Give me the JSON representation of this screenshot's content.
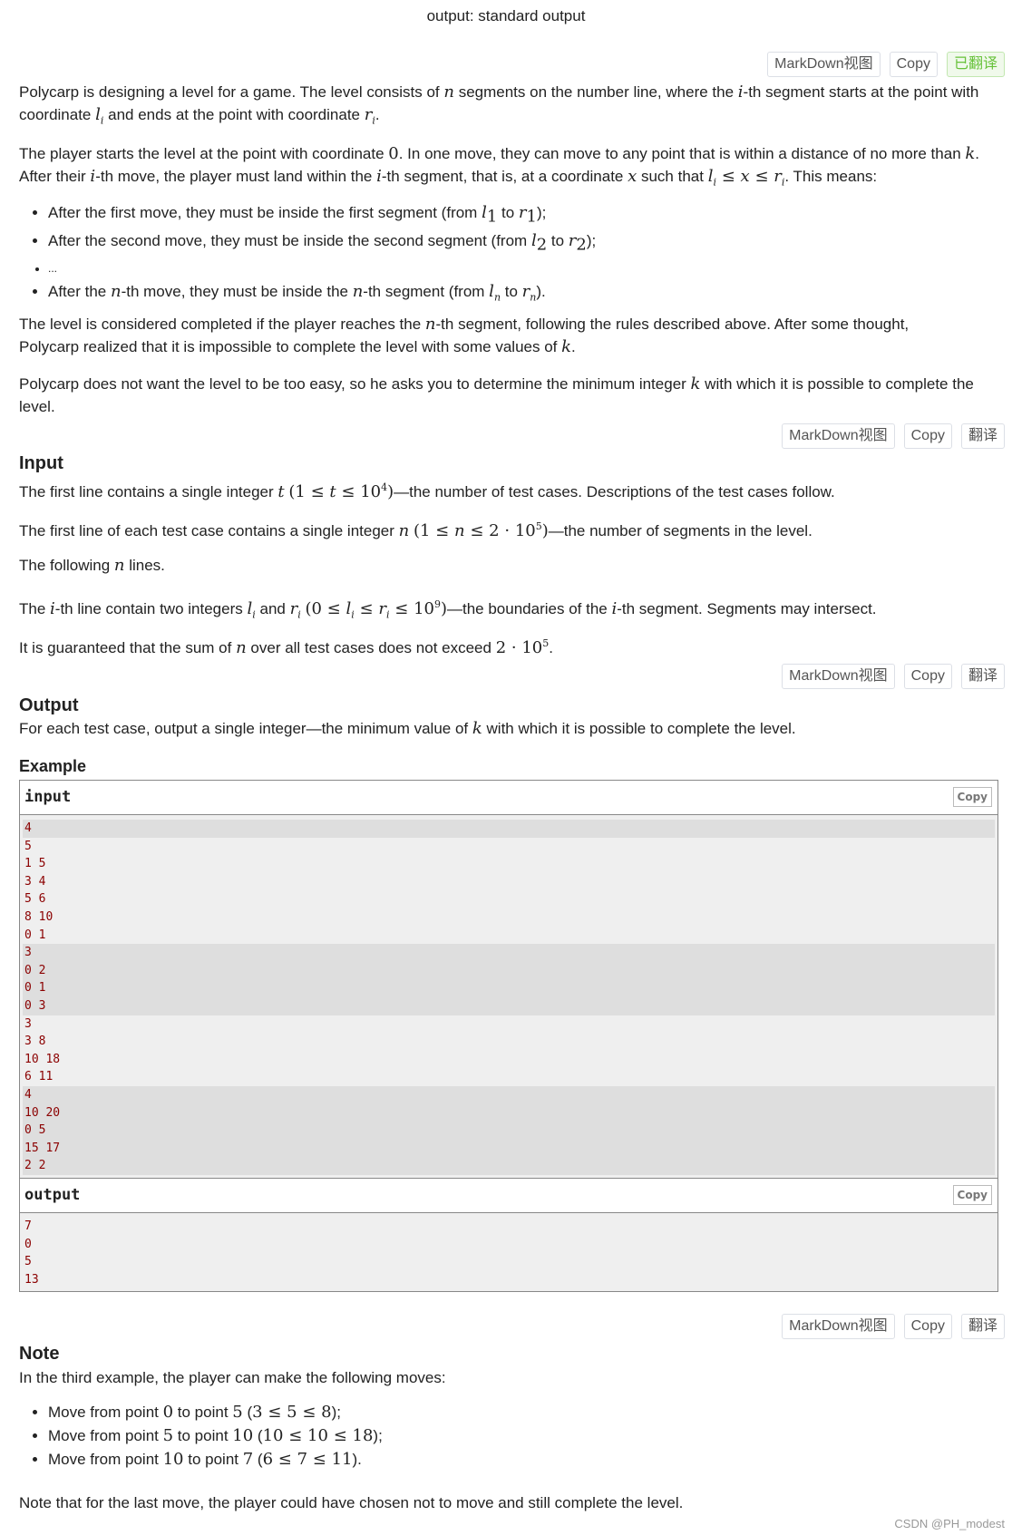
{
  "header": {
    "output_line": "output: standard output"
  },
  "toolbars": {
    "statement": {
      "markdown": "MarkDown视图",
      "copy": "Copy",
      "translate": "已翻译"
    },
    "input": {
      "markdown": "MarkDown视图",
      "copy": "Copy",
      "translate": "翻译"
    },
    "output": {
      "markdown": "MarkDown视图",
      "copy": "Copy",
      "translate": "翻译"
    },
    "note": {
      "markdown": "MarkDown视图",
      "copy": "Copy",
      "translate": "翻译"
    }
  },
  "colors": {
    "translated_green": "#67c23a",
    "code_text": "#8b0000",
    "code_bg": "#efefef",
    "code_alt_bg": "#dedede"
  },
  "statement": {
    "p1_a": "Polycarp is designing a level for a game. The level consists of ",
    "p1_b": " segments on the number line, where the ",
    "p1_c": "-th segment starts at the point with coordinate ",
    "p1_d": " and ends at the point with coordinate ",
    "p1_e": ".",
    "p2_a": "The player starts the level at the point with coordinate ",
    "p2_b": ". In one move, they can move to any point that is within a distance of no more than ",
    "p2_c": ". After their ",
    "p2_d": "-th move, the player must land within the ",
    "p2_e": "-th segment, that is, at a coordinate ",
    "p2_f": " such that ",
    "p2_g": ". This means:",
    "bullets": [
      {
        "a": "After the first move, they must be inside the first segment (from ",
        "l": "l",
        "ls": "1",
        "mid": " to ",
        "r": "r",
        "rs": "1",
        "end": ");"
      },
      {
        "a": "After the second move, they must be inside the second segment (from ",
        "l": "l",
        "ls": "2",
        "mid": " to ",
        "r": "r",
        "rs": "2",
        "end": ");"
      },
      {
        "a": "..."
      },
      {
        "a": "After the ",
        "n": "n",
        "b": "-th move, they must be inside the ",
        "n2": "n",
        "c": "-th segment (from ",
        "l": "l",
        "ls": "n",
        "mid": " to ",
        "r": "r",
        "rs": "n",
        "end": ")."
      }
    ],
    "p3_a": "The level is considered completed if the player reaches the ",
    "p3_b": "-th segment, following the rules described above. After some thought, Polycarp realized that it is impossible to complete the level with some values of ",
    "p3_c": ".",
    "p4_a": "Polycarp does not want the level to be too easy, so he asks you to determine the minimum integer ",
    "p4_b": " with which it is possible to complete the level."
  },
  "math": {
    "n": "n",
    "i": "i",
    "l": "l",
    "r": "r",
    "sub_i": "i",
    "zero": "0",
    "k": "k",
    "x": "x",
    "leq": "≤",
    "t": "t",
    "one": "1",
    "ten": "10",
    "exp4": "4",
    "two": "2",
    "dot": "·",
    "exp5": "5",
    "exp9": "9"
  },
  "input_section": {
    "title": "Input",
    "p1_a": "The first line contains a single integer ",
    "p1_b": "—the number of test cases. Descriptions of the test cases follow.",
    "p2_a": "The first line of each test case contains a single integer ",
    "p2_b": "—the number of segments in the level.",
    "p3_a": "The following ",
    "p3_b": " lines.",
    "p4_a": "The ",
    "p4_b": "-th line contain two integers ",
    "p4_c": " and ",
    "p4_d": "—the boundaries of the ",
    "p4_e": "-th segment. Segments may intersect.",
    "p5_a": "It is guaranteed that the sum of ",
    "p5_b": " over all test cases does not exceed ",
    "p5_c": "."
  },
  "output_section": {
    "title": "Output",
    "p1_a": "For each test case, output a single integer—the minimum value of ",
    "p1_b": " with which it is possible to complete the level."
  },
  "example": {
    "title": "Example",
    "input_label": "input",
    "output_label": "output",
    "copy_label": "Copy",
    "input_lines": [
      {
        "text": "4",
        "dark": true
      },
      {
        "text": "5",
        "dark": false
      },
      {
        "text": "1 5",
        "dark": false
      },
      {
        "text": "3 4",
        "dark": false
      },
      {
        "text": "5 6",
        "dark": false
      },
      {
        "text": "8 10",
        "dark": false
      },
      {
        "text": "0 1",
        "dark": false
      },
      {
        "text": "3",
        "dark": true
      },
      {
        "text": "0 2",
        "dark": true
      },
      {
        "text": "0 1",
        "dark": true
      },
      {
        "text": "0 3",
        "dark": true
      },
      {
        "text": "3",
        "dark": false
      },
      {
        "text": "3 8",
        "dark": false
      },
      {
        "text": "10 18",
        "dark": false
      },
      {
        "text": "6 11",
        "dark": false
      },
      {
        "text": "4",
        "dark": true
      },
      {
        "text": "10 20",
        "dark": true
      },
      {
        "text": "0 5",
        "dark": true
      },
      {
        "text": "15 17",
        "dark": true
      },
      {
        "text": "2 2",
        "dark": true
      }
    ],
    "output_lines": [
      "7",
      "0",
      "5",
      "13"
    ]
  },
  "note": {
    "title": "Note",
    "intro": "In the third example, the player can make the following moves:",
    "moves": [
      {
        "a": "Move from point ",
        "from": "0",
        "b": " to point ",
        "to": "5",
        "c": " (",
        "lo": "3",
        "v": "5",
        "hi": "8",
        "end": ");"
      },
      {
        "a": "Move from point ",
        "from": "5",
        "b": " to point ",
        "to": "10",
        "c": " (",
        "lo": "10",
        "v": "10",
        "hi": "18",
        "end": ");"
      },
      {
        "a": "Move from point ",
        "from": "10",
        "b": " to point ",
        "to": "7",
        "c": " (",
        "lo": "6",
        "v": "7",
        "hi": "11",
        "end": ")."
      }
    ],
    "outro": "Note that for the last move, the player could have chosen not to move and still complete the level."
  },
  "watermark": "CSDN @PH_modest"
}
